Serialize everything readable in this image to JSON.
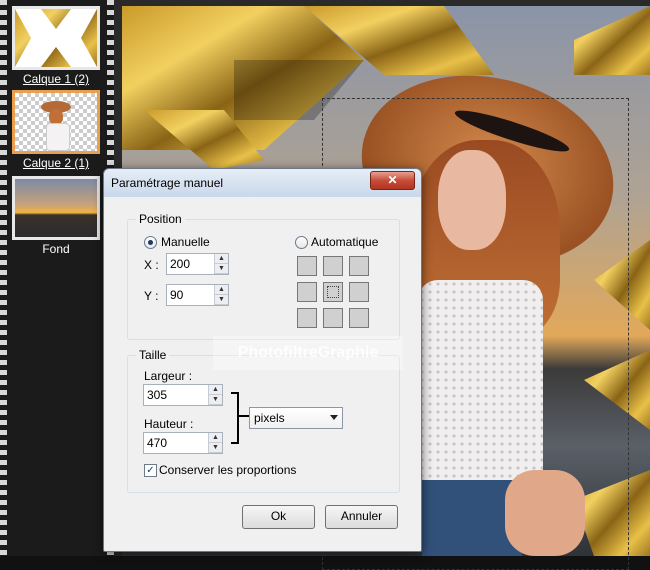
{
  "layers": [
    {
      "name": "Calque 1 (2)",
      "selected": false,
      "thumb": "gold-arrows"
    },
    {
      "name": "Calque 2 (1)",
      "selected": true,
      "thumb": "woman-cutout"
    },
    {
      "name": "Fond",
      "selected": false,
      "thumb": "sunset-beach"
    }
  ],
  "dialog": {
    "title": "Paramétrage manuel",
    "close_icon": "close-icon",
    "position": {
      "group_label": "Position",
      "manual_label": "Manuelle",
      "auto_label": "Automatique",
      "selected_mode": "Manuelle",
      "x_label": "X :",
      "x_value": "200",
      "y_label": "Y :",
      "y_value": "90"
    },
    "size": {
      "group_label": "Taille",
      "width_label": "Largeur :",
      "width_value": "305",
      "height_label": "Hauteur :",
      "height_value": "470",
      "unit_value": "pixels",
      "keep_ratio_label": "Conserver les proportions",
      "keep_ratio_checked": true
    },
    "ok_label": "Ok",
    "cancel_label": "Annuler"
  },
  "watermark": "PhotofiltreGraphie",
  "colors": {
    "selection_accent": "#e8a050",
    "close_button": "#c74c3a"
  }
}
